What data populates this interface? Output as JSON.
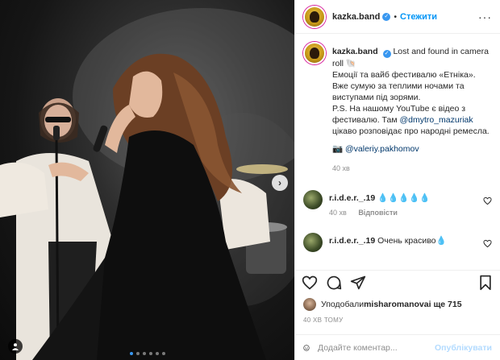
{
  "header": {
    "username": "kazka.band",
    "separator": "•",
    "follow_label": "Стежити",
    "more_label": "···"
  },
  "caption": {
    "username": "kazka.band",
    "line1": "Lost and found in camera roll 🐚",
    "line2": "Емоції та вайб фестивалю «Етніка». Вже сумую за теплими ночами та виступами під зорями.",
    "line3_a": "P.S. На нашому YouTube є відео з фестивалю. Там ",
    "mention1": "@dmytro_mazuriak",
    "line3_b": " цікаво розповідає про народні ремесла.",
    "camera_glyph": "📷",
    "mention2": "@valeriy.pakhomov",
    "time": "40 хв"
  },
  "comments": [
    {
      "username": "r.i.d.e.r._.19",
      "text": "💧💧💧💧💧",
      "time": "40 хв",
      "reply_label": "Відповісти"
    },
    {
      "username": "r.i.d.e.r._.19",
      "text": "Очень красиво💧"
    }
  ],
  "likes": {
    "prefix": "Уподобали ",
    "user": "misharomanova",
    "suffix": " і ще 715"
  },
  "post_time": "40 хв тому",
  "add_comment": {
    "placeholder": "Додайте коментар...",
    "publish_label": "Опублікувати"
  },
  "media": {
    "slides": 6,
    "active_slide": 0
  },
  "icons": {
    "header_more": "more-icon",
    "emoji": "emoji-icon",
    "like": "heart-icon",
    "comment": "comment-icon",
    "share": "share-icon",
    "save": "bookmark-icon",
    "next": "chevron-right-icon",
    "tag": "user-tag-icon"
  },
  "colors": {
    "accent": "#0095f6",
    "muted": "#8e8e8e",
    "text": "#262626",
    "publish_disabled": "#b3dbff"
  }
}
